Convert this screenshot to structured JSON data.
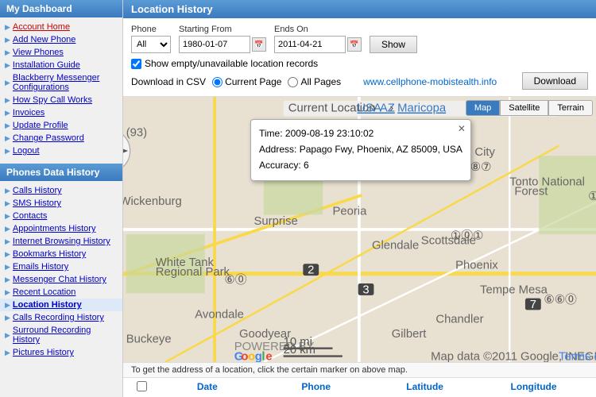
{
  "sidebar": {
    "my_dashboard_label": "My Dashboard",
    "phones_data_label": "Phones Data History",
    "my_dashboard_items": [
      {
        "label": "Account Home",
        "style": "red-link"
      },
      {
        "label": "Add New Phone",
        "style": "blue-link"
      },
      {
        "label": "View Phones",
        "style": "blue-link"
      },
      {
        "label": "Installation Guide",
        "style": "blue-link"
      },
      {
        "label": "Blackberry Messenger Configurations",
        "style": "blue-link"
      },
      {
        "label": "How Spy Call Works",
        "style": "blue-link"
      },
      {
        "label": "Invoices",
        "style": "blue-link"
      },
      {
        "label": "Update Profile",
        "style": "blue-link"
      },
      {
        "label": "Change Password",
        "style": "blue-link"
      },
      {
        "label": "Logout",
        "style": "blue-link"
      }
    ],
    "phones_data_items": [
      {
        "label": "Calls History",
        "style": "blue-link"
      },
      {
        "label": "SMS History",
        "style": "blue-link"
      },
      {
        "label": "Contacts",
        "style": "blue-link"
      },
      {
        "label": "Appointments History",
        "style": "blue-link"
      },
      {
        "label": "Internet Browsing History",
        "style": "blue-link"
      },
      {
        "label": "Bookmarks History",
        "style": "blue-link"
      },
      {
        "label": "Emails History",
        "style": "blue-link"
      },
      {
        "label": "Messenger Chat History",
        "style": "blue-link"
      },
      {
        "label": "Recent Location",
        "style": "blue-link"
      },
      {
        "label": "Location History",
        "style": "active-item blue-link"
      },
      {
        "label": "Calls Recording History",
        "style": "blue-link"
      },
      {
        "label": "Surround Recording History",
        "style": "blue-link"
      },
      {
        "label": "Pictures History",
        "style": "blue-link"
      }
    ]
  },
  "main": {
    "title": "Location History",
    "controls": {
      "phone_label": "Phone",
      "phone_value": "All",
      "starting_from_label": "Starting From",
      "starting_from_value": "1980-01-07",
      "ends_on_label": "Ends On",
      "ends_on_value": "2011-04-21",
      "show_button": "Show",
      "checkbox_label": "Show empty/unavailable location records",
      "download_csv_label": "Download in CSV",
      "current_page_label": "Current Page",
      "all_pages_label": "All Pages",
      "site_link": "www.cellphone-mobistealth.info",
      "download_button": "Download"
    },
    "map": {
      "type_buttons": [
        "Map",
        "Satellite",
        "Terrain"
      ],
      "active_type": "Map",
      "popup": {
        "time": "Time: 2009-08-19 23:10:02",
        "address": "Address: Papago Fwy, Phoenix, AZ 85009, USA",
        "accuracy": "Accuracy: 6"
      },
      "current_location_label": "Current Location",
      "usa_link": "USA",
      "az_link": "AZ",
      "maricopa_link": "Maricopa"
    },
    "map_bottom_text": "To get the address of a location, click the certain marker on above map.",
    "table_headers": [
      "",
      "Date",
      "Phone",
      "Latitude",
      "Longitude"
    ]
  }
}
